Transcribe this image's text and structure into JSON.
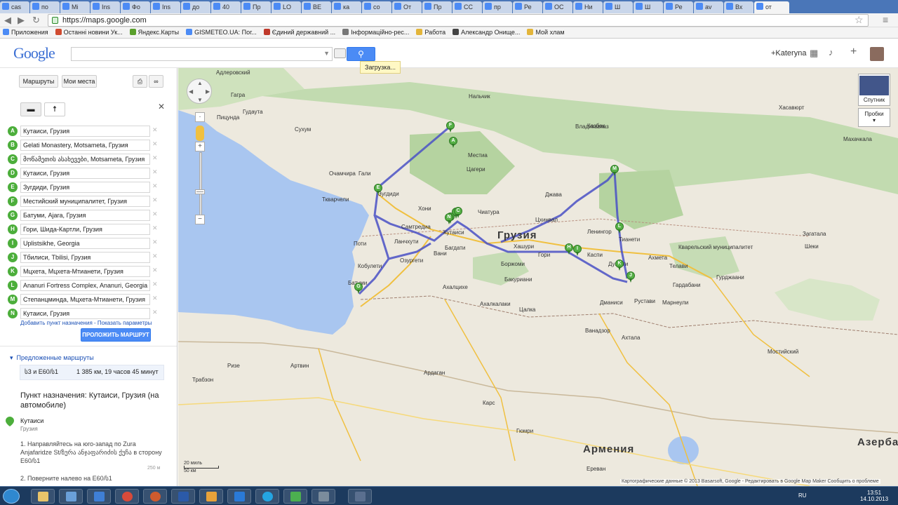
{
  "browser": {
    "tabs": [
      "cas",
      "по",
      "Mi",
      "Ins",
      "Фо",
      "Ins",
      "до",
      "40",
      "Пр",
      "LO",
      "ВЕ",
      "ка",
      "со",
      "От",
      "Пр",
      "СС",
      "пр",
      "Ре",
      "ОС",
      "Ни",
      "Ш",
      "Ш",
      "Ре",
      "av",
      "Вх",
      "от"
    ],
    "url": "https://maps.google.com",
    "bookmarks": [
      "Приложения",
      "Останні новини Ук...",
      "Яндекс.Карты",
      "GISMETEO.UA: Пог...",
      "Єдиний державний ...",
      "Інформаційно-рес...",
      "Работа",
      "Александр Онище...",
      "Мой хлам"
    ]
  },
  "gbar": {
    "logo": "Google",
    "search_value": "",
    "user": "+Kateryna",
    "loading": "Загрузка..."
  },
  "panel": {
    "tab_routes": "Маршруты",
    "tab_places": "Мои места",
    "waypoints": [
      {
        "letter": "A",
        "text": "Кутаиси, Грузия"
      },
      {
        "letter": "B",
        "text": "Gelati Monastery, Motsameta, Грузия"
      },
      {
        "letter": "C",
        "text": "მოწამეთის ასახევები, Motsameta, Грузия"
      },
      {
        "letter": "D",
        "text": "Кутаиси, Грузия"
      },
      {
        "letter": "E",
        "text": "Зугдиди, Грузия"
      },
      {
        "letter": "F",
        "text": "Местийский муниципалитет, Грузия"
      },
      {
        "letter": "G",
        "text": "Батуми, Ajara, Грузия"
      },
      {
        "letter": "H",
        "text": "Гори, Шида-Картли, Грузия"
      },
      {
        "letter": "I",
        "text": "Uplistsikhe, Georgia"
      },
      {
        "letter": "J",
        "text": "Тбилиси, Tbilisi, Грузия"
      },
      {
        "letter": "K",
        "text": "Мцхета, Мцхета-Мтианети, Грузия"
      },
      {
        "letter": "L",
        "text": "Ananuri Fortress Complex, Ananuri, Georgia"
      },
      {
        "letter": "M",
        "text": "Степанцминда, Мцхета-Мтианети, Грузия"
      },
      {
        "letter": "N",
        "text": "Кутаиси, Грузия"
      }
    ],
    "add_links": "Добавить пункт назначения - Показать параметры",
    "route_button": "ПРОЛОЖИТЬ МАРШРУТ",
    "suggested": "Предложенные маршруты",
    "route_road": "ს3 и E60/ს1",
    "route_summary": "1 385 км, 19 часов 45 минут",
    "destination": "Пункт назначения: Кутаиси, Грузия (на автомобиле)",
    "start_city": "Кутаиси",
    "start_country": "Грузия",
    "step1": "1. Направляйтесь на юго-запад по Zura Anjafaridze St/ზურა ანჯაფარიძის ქუჩა в сторону E60/ს1",
    "step1_dist": "250 м",
    "step2": "2. Поверните налево на E60/ს1"
  },
  "map": {
    "country_main": "Грузия",
    "country_armenia": "Армения",
    "country_az": "Азерба",
    "satellite": "Спутник",
    "traffic": "Пробки",
    "scale_top": "20 миль",
    "scale_bottom": "50 км",
    "footer": "Картографические данные © 2013 Basarsoft, Google -   Редактировать в Google Map Maker   Сообщить о проблеме",
    "labels": [
      "Адлеровский",
      "Гагра",
      "Пицунда",
      "Гудаута",
      "Сухум",
      "Очамчира",
      "Гали",
      "Зугдиди",
      "Хони",
      "Кутаиси",
      "Чиатура",
      "Самтредиа",
      "Поти",
      "Ланчхути",
      "Озургети",
      "Кобулети",
      "Батуми",
      "Хашури",
      "Гори",
      "Каспи",
      "Ахалцихе",
      "Боржоми",
      "Бакуриани",
      "Ахалкалаки",
      "Цхинвал",
      "Джава",
      "Душети",
      "Тианети",
      "Ленингор",
      "Рустави",
      "Ахмета",
      "Кварельский муниципалитет",
      "Гурджаани",
      "Телави",
      "Казбек",
      "Хасавюрт",
      "Махачкала",
      "Нальчик",
      "Владикавказ",
      "Мостийский",
      "Карс",
      "Ереван",
      "Гюмри",
      "Ардаган",
      "Артвин",
      "Ризе",
      "Трабзон",
      "Вани",
      "Багдати",
      "Цагери",
      "Местиа",
      "Ткварчели",
      "Загатала",
      "Шеки",
      "Гардабани",
      "Ванадзор",
      "Марнеули",
      "Дманиси",
      "Ахтала",
      "Цалка"
    ],
    "markers": [
      "A",
      "B",
      "C",
      "D",
      "E",
      "F",
      "G",
      "H",
      "I",
      "J",
      "K",
      "L",
      "M",
      "N"
    ]
  },
  "taskbar": {
    "lang": "RU",
    "time": "13:51",
    "date": "14.10.2013"
  }
}
